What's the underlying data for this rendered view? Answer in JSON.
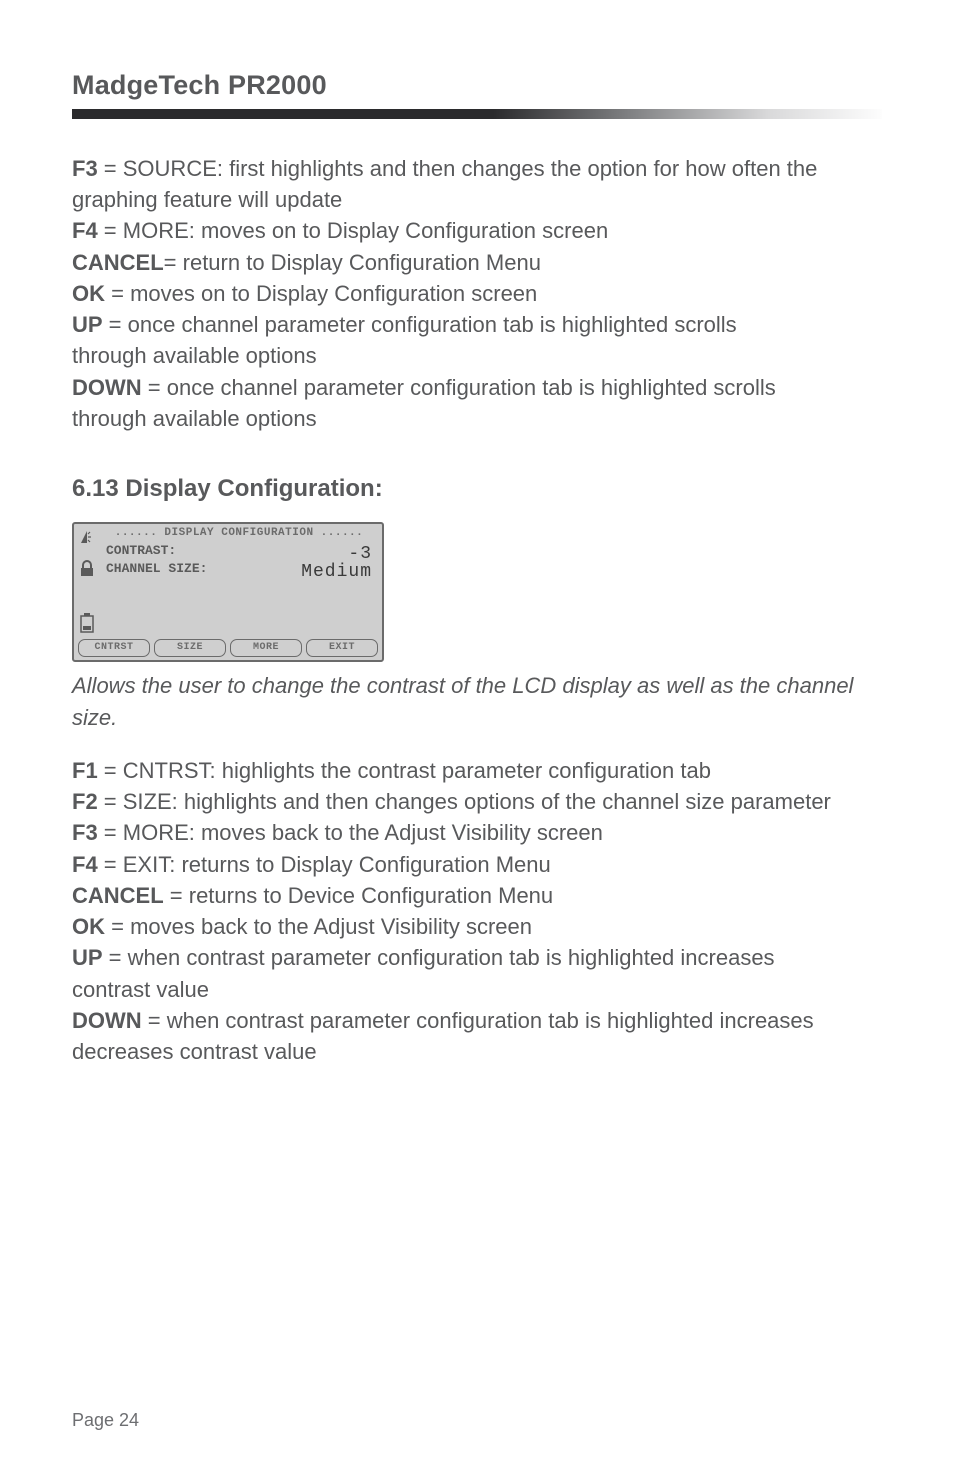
{
  "header": {
    "title": "MadgeTech  PR2000"
  },
  "section_a": {
    "items": [
      {
        "key": "F3",
        "text_a": " = SOURCE: first highlights and then changes the option for how often the",
        "text_b": "graphing feature will update"
      },
      {
        "key": "F4",
        "text_a": " = MORE: moves on to Display Configuration screen",
        "text_b": ""
      },
      {
        "key": "CANCEL",
        "text_a": "= return to Display Configuration Menu",
        "text_b": ""
      },
      {
        "key": "OK",
        "text_a": " = moves on to Display Configuration screen",
        "text_b": ""
      },
      {
        "key": "UP",
        "text_a": " = once channel parameter configuration tab is highlighted scrolls",
        "text_b": "through available options"
      },
      {
        "key": "DOWN",
        "text_a": " = once channel parameter configuration tab is highlighted scrolls",
        "text_b": "through available options"
      }
    ]
  },
  "section_b": {
    "heading": "6.13 Display Configuration:",
    "lcd": {
      "title": "...... DISPLAY CONFIGURATION ......",
      "rows": [
        {
          "label": "CONTRAST:",
          "value": "-3"
        },
        {
          "label": "CHANNEL SIZE:",
          "value": "Medium"
        }
      ],
      "buttons": [
        "CNTRST",
        "SIZE",
        "MORE",
        "EXIT"
      ]
    },
    "caption": "Allows the user to change the contrast of the LCD display as well as the channel size.",
    "items": [
      {
        "key": "F1",
        "text_a": " = CNTRST: highlights the contrast parameter configuration tab",
        "text_b": ""
      },
      {
        "key": "F2",
        "text_a": " = SIZE: highlights and then changes options of the channel size parameter",
        "text_b": ""
      },
      {
        "key": "F3",
        "text_a": " = MORE: moves back to the Adjust Visibility screen",
        "text_b": ""
      },
      {
        "key": "F4",
        "text_a": " = EXIT: returns to Display Configuration Menu",
        "text_b": ""
      },
      {
        "key": "CANCEL",
        "text_a": " = returns to Device Configuration Menu",
        "text_b": ""
      },
      {
        "key": "OK",
        "text_a": " = moves back to the Adjust Visibility screen",
        "text_b": ""
      },
      {
        "key": "UP",
        "text_a": " = when contrast parameter configuration tab is highlighted increases",
        "text_b": "contrast value"
      },
      {
        "key": "DOWN",
        "text_a": " = when contrast parameter configuration tab is highlighted increases",
        "text_b": "decreases contrast value"
      }
    ]
  },
  "footer": {
    "page_label": "Page 24"
  }
}
